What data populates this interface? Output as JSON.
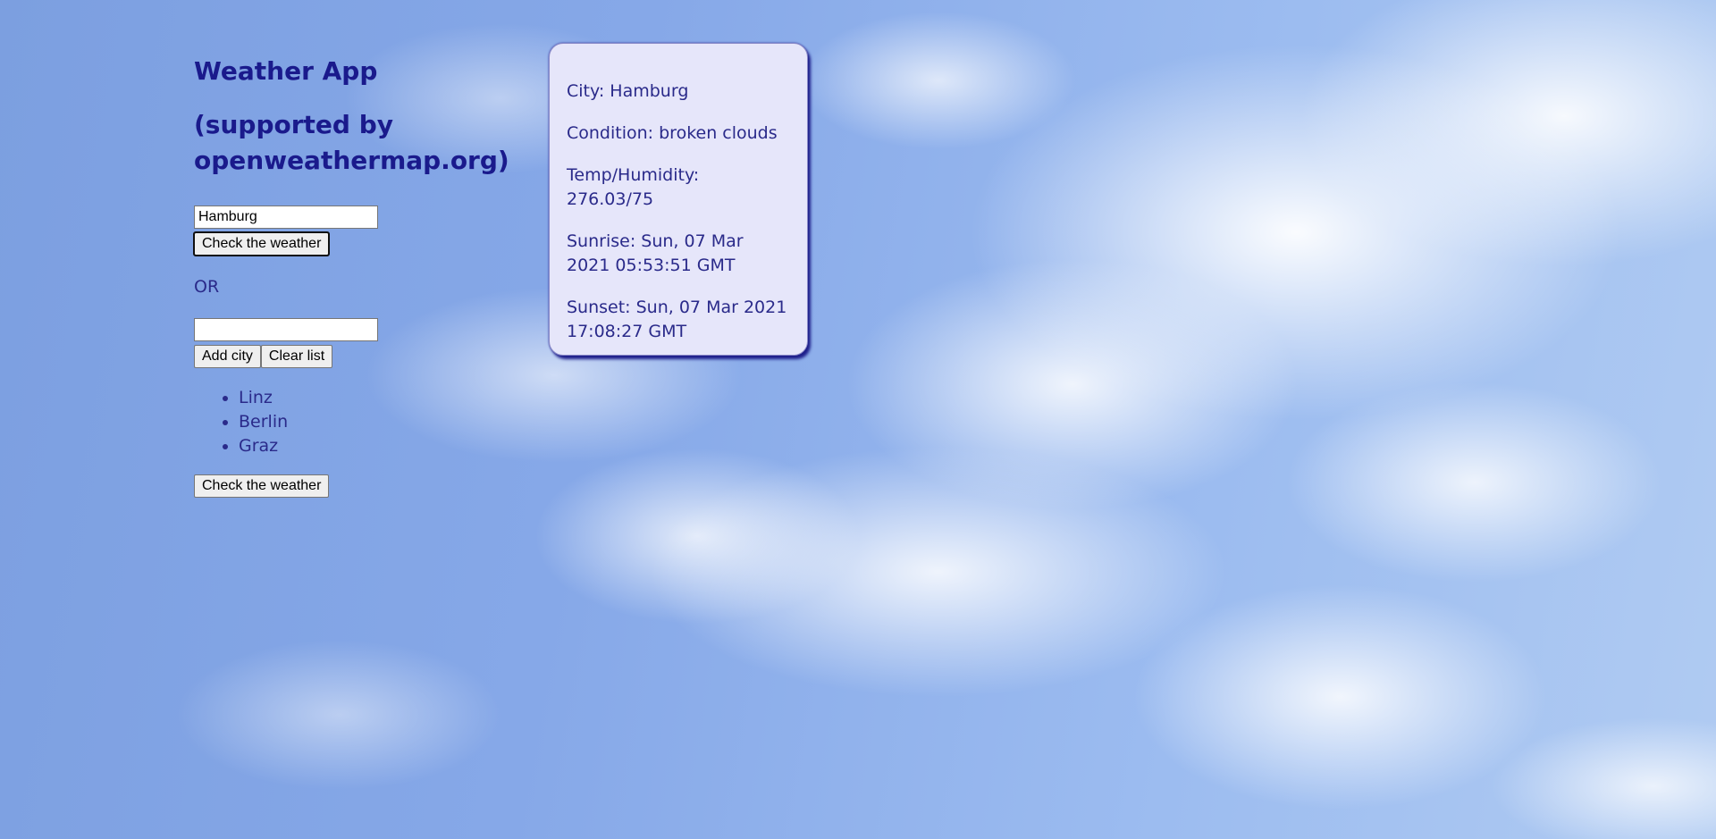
{
  "app": {
    "title": "Weather App",
    "subtitle": "(supported by openweathermap.org)"
  },
  "search": {
    "city_value": "Hamburg",
    "check_button_label": "Check the weather",
    "or_label": "OR"
  },
  "list_section": {
    "input_value": "",
    "add_button_label": "Add city",
    "clear_button_label": "Clear list",
    "cities": [
      "Linz",
      "Berlin",
      "Graz"
    ],
    "check_button_label": "Check the weather"
  },
  "weather_card": {
    "city": "City: Hamburg",
    "condition": "Condition: broken clouds",
    "temp_humidity": "Temp/Humidity: 276.03/75",
    "sunrise": "Sunrise: Sun, 07 Mar 2021 05:53:51 GMT",
    "sunset": "Sunset: Sun, 07 Mar 2021 17:08:27 GMT"
  },
  "colors": {
    "heading": "#1a1a8c",
    "text": "#2a2a8a",
    "card_background": "#e6e6fa",
    "sky": "#86a8e8"
  },
  "background": "sky-with-clouds"
}
